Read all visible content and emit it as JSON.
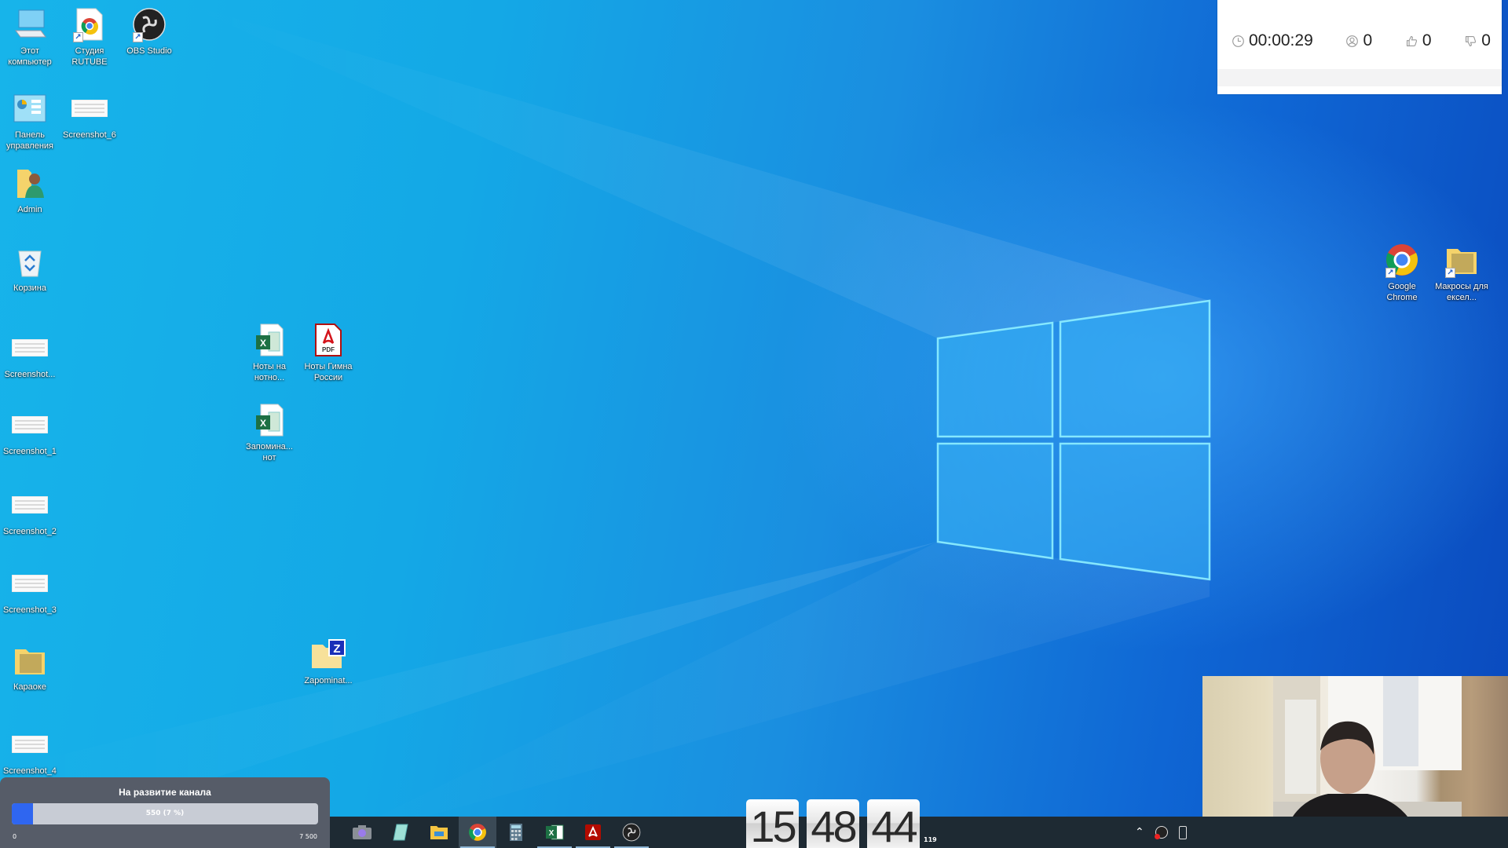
{
  "desktop": {
    "icons": [
      {
        "label": "Этот компьютер",
        "icon": "computer-icon",
        "shortcut": false
      },
      {
        "label": "Студия RUTUBE",
        "icon": "chrome-doc-icon",
        "shortcut": true
      },
      {
        "label": "OBS Studio",
        "icon": "obs-icon",
        "shortcut": true
      },
      {
        "label": "Панель управления",
        "icon": "control-panel-icon",
        "shortcut": false
      },
      {
        "label": "Screenshot_6",
        "icon": "image-thumbnail-icon",
        "shortcut": false
      },
      {
        "label": "Admin",
        "icon": "user-folder-icon",
        "shortcut": false
      },
      {
        "label": "Корзина",
        "icon": "recycle-bin-icon",
        "shortcut": false
      },
      {
        "label": "Screenshot...",
        "icon": "image-thumbnail-icon",
        "shortcut": false
      },
      {
        "label": "Screenshot_1",
        "icon": "image-thumbnail-icon",
        "shortcut": false
      },
      {
        "label": "Screenshot_2",
        "icon": "image-thumbnail-icon",
        "shortcut": false
      },
      {
        "label": "Screenshot_3",
        "icon": "image-thumbnail-icon",
        "shortcut": false
      },
      {
        "label": "Караоке",
        "icon": "folder-icon",
        "shortcut": false
      },
      {
        "label": "Screenshot_4",
        "icon": "image-thumbnail-icon",
        "shortcut": false
      },
      {
        "label": "Ноты на нотно...",
        "icon": "excel-file-icon",
        "shortcut": false
      },
      {
        "label": "Ноты Гимна России",
        "icon": "pdf-file-icon",
        "shortcut": false
      },
      {
        "label": "Запомина... нот",
        "icon": "excel-file-icon",
        "shortcut": false
      },
      {
        "label": "Zapominat...",
        "icon": "zip-folder-icon",
        "shortcut": false
      },
      {
        "label": "Google Chrome",
        "icon": "chrome-icon",
        "shortcut": true
      },
      {
        "label": "Макросы для ексел...",
        "icon": "folder-icon",
        "shortcut": true
      }
    ]
  },
  "stream_stats": {
    "duration": "00:00:29",
    "viewers": "0",
    "likes": "0",
    "dislikes": "0"
  },
  "donation_goal": {
    "title": "На развитие канала",
    "progress_text": "550 (7 %)",
    "current": 550,
    "goal": 7500,
    "percent": 7,
    "min_label": "0",
    "max_label": "7 500",
    "fill_color": "#2f66f0"
  },
  "taskbar": {
    "apps": [
      {
        "name": "camera",
        "icon": "camera-icon",
        "active": false,
        "running": false
      },
      {
        "name": "notepad",
        "icon": "notepad-icon",
        "active": false,
        "running": false
      },
      {
        "name": "file-explorer",
        "icon": "folder-icon",
        "active": false,
        "running": false
      },
      {
        "name": "google-chrome",
        "icon": "chrome-icon",
        "active": true,
        "running": true
      },
      {
        "name": "calculator",
        "icon": "calculator-icon",
        "active": false,
        "running": false
      },
      {
        "name": "excel",
        "icon": "excel-icon",
        "active": false,
        "running": true
      },
      {
        "name": "acrobat-reader",
        "icon": "pdf-icon",
        "active": false,
        "running": true
      },
      {
        "name": "obs-studio",
        "icon": "obs-icon",
        "active": false,
        "running": true
      }
    ],
    "tray": [
      "chevron-up-icon",
      "obs-tray-icon",
      "usb-icon"
    ]
  },
  "clock_widget": {
    "hours": "15",
    "minutes": "48",
    "seconds": "44",
    "small_label": "119"
  },
  "colors": {
    "accent": "#0f66d4",
    "taskbar_bg": "#1e2a33",
    "donate_bg": "#565c68"
  }
}
